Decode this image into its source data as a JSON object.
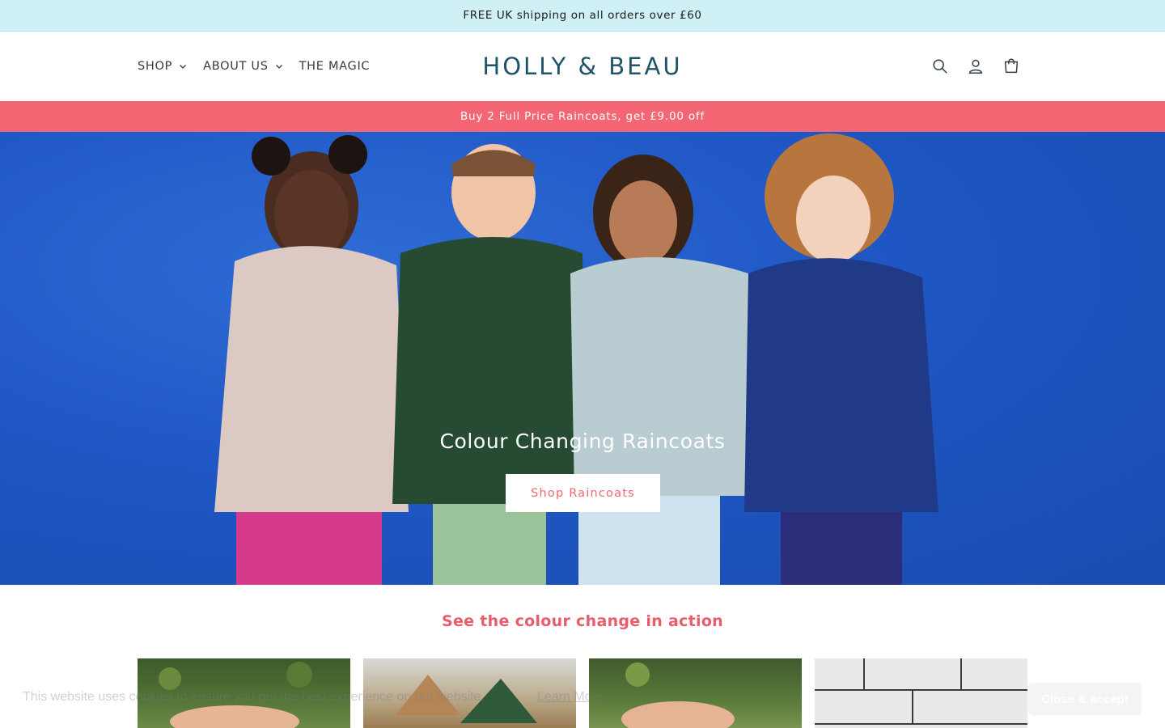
{
  "announcement": {
    "text": "FREE UK shipping on all orders over £60"
  },
  "header": {
    "nav": [
      {
        "label": "SHOP",
        "has_dropdown": true
      },
      {
        "label": "ABOUT US",
        "has_dropdown": true
      },
      {
        "label": "THE MAGIC",
        "has_dropdown": false
      }
    ],
    "logo": "HOLLY & BEAU",
    "icons": [
      "search-icon",
      "account-icon",
      "cart-icon"
    ]
  },
  "promo": {
    "text": "Buy 2 Full Price Raincoats, get £9.00 off"
  },
  "hero": {
    "title": "Colour Changing Raincoats",
    "button_label": "Shop Raincoats"
  },
  "section": {
    "title": "See the colour change in action"
  },
  "cookie_banner": {
    "text": "This website uses cookies to ensure you get the best experience on our website.",
    "link_label": "Learn More",
    "accept_label": "Close & accept"
  },
  "colors": {
    "announcement_bg": "#cff1f5",
    "promo_bg": "#f46674",
    "accent": "#e85d6b",
    "logo": "#1e5468",
    "hero_wall": "#1f57c4"
  }
}
